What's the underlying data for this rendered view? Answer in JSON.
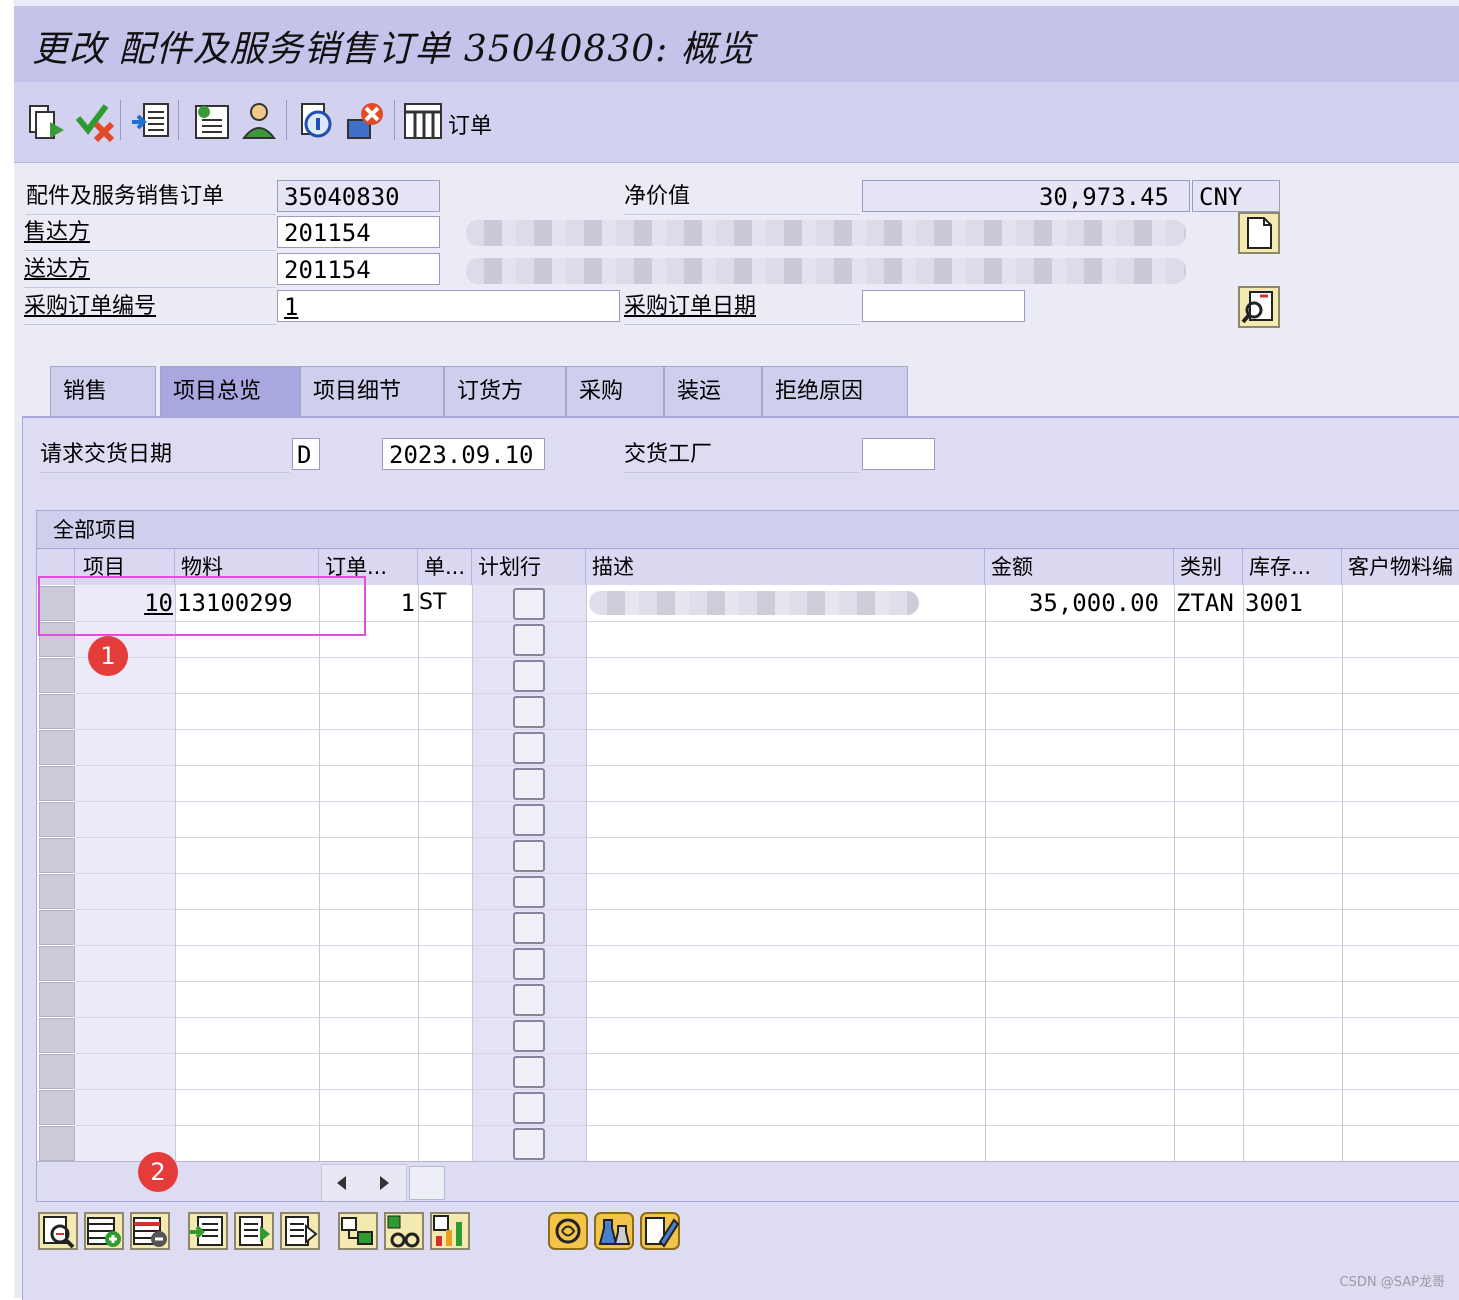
{
  "window": {
    "title": "更改 配件及服务销售订单 35040830: 概览"
  },
  "toolbar": {
    "buttons": [
      "display-change-icon",
      "check-icon",
      "import-icon",
      "header-detail-icon",
      "partner-icon",
      "doc-flow-icon",
      "delete-icon",
      "item-overview-icon"
    ],
    "order_label": "订单"
  },
  "header": {
    "order_label": "配件及服务销售订单",
    "order_number": "35040830",
    "net_value_label": "净价值",
    "net_value": "30,973.45",
    "currency": "CNY",
    "sold_to_label": "售达方",
    "sold_to": "201154",
    "ship_to_label": "送达方",
    "ship_to": "201154",
    "po_number_label": "采购订单编号",
    "po_number": "1",
    "po_date_label": "采购订单日期",
    "po_date": ""
  },
  "tabs": [
    "销售",
    "项目总览",
    "项目细节",
    "订货方",
    "采购",
    "装运",
    "拒绝原因"
  ],
  "active_tab": "项目总览",
  "delivery": {
    "date_label": "请求交货日期",
    "date_type": "D",
    "date": "2023.09.10",
    "plant_label": "交货工厂",
    "plant": ""
  },
  "items_table": {
    "title": "全部项目",
    "columns": [
      "项目",
      "物料",
      "订单...",
      "单...",
      "计划行",
      "描述",
      "金额",
      "类别",
      "库存...",
      "客户物料编"
    ],
    "rows": [
      {
        "item": "10",
        "material": "13100299",
        "qty": "1",
        "unit": "ST",
        "schedule": false,
        "desc": "",
        "amount": "35,000.00",
        "category": "ZTAN",
        "storage": "3001",
        "cust_material": ""
      }
    ]
  },
  "annotations": {
    "badge1": "1",
    "badge2": "2"
  },
  "watermark": "CSDN @SAP龙哥"
}
